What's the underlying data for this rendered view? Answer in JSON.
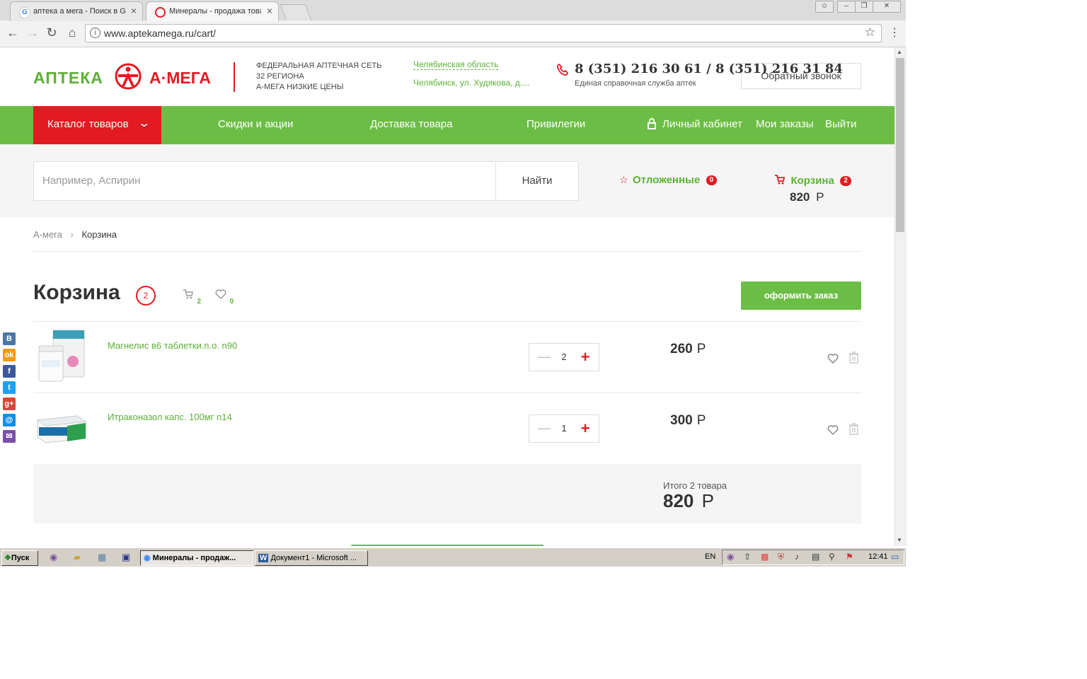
{
  "browser": {
    "tabs": [
      {
        "title": "аптека а мега - Поиск в G",
        "active": false
      },
      {
        "title": "Минералы - продажа това",
        "active": true
      }
    ],
    "url": "www.aptekamega.ru/cart/"
  },
  "header": {
    "logo_left": "АПТЕКА",
    "logo_right": "А·МЕГА",
    "tagline": [
      "ФЕДЕРАЛЬНАЯ АПТЕЧНАЯ СЕТЬ",
      "32 РЕГИОНА",
      "А-МЕГА НИЗКИЕ ЦЕНЫ"
    ],
    "region": "Челябинская область",
    "address": "Челябинск, ул. Худякова, д....",
    "phone": "8 (351) 216 30 61 / 8 (351) 216 31 84",
    "phone_caption": "Единая справочная служба аптек",
    "callback_label": "Обратный звонок"
  },
  "nav": {
    "catalog": "Каталог товаров",
    "items": [
      "Скидки и акции",
      "Доставка товара",
      "Привилегии"
    ],
    "account": "Личный кабинет",
    "orders": "Мои заказы",
    "logout": "Выйти"
  },
  "search": {
    "placeholder": "Например, Аспирин",
    "button": "Найти",
    "deferred_label": "Отложенные",
    "deferred_count": "0",
    "cart_label": "Корзина",
    "cart_count": "2",
    "cart_total": "820",
    "currency": "Р"
  },
  "breadcrumb": {
    "home": "А-мега",
    "current": "Корзина"
  },
  "cart": {
    "title": "Корзина",
    "count": "2",
    "cart_icon_count": "2",
    "fav_icon_count": "0",
    "checkout_label": "оформить заказ",
    "items": [
      {
        "name": "Магнелис в6 таблетки.п.о. n90",
        "qty": "2",
        "price": "260",
        "currency": "Р"
      },
      {
        "name": "Итраконазол капс. 100мг n14",
        "qty": "1",
        "price": "300",
        "currency": "Р"
      }
    ],
    "summary_label": "Итого 2 товара",
    "summary_total": "820",
    "summary_currency": "Р"
  },
  "social": [
    "В",
    "ok",
    "f",
    "t",
    "g+",
    "@",
    "✉"
  ],
  "colors": {
    "green": "#6cbd45",
    "red": "#e21a22",
    "link_green": "#5cb135"
  },
  "taskbar": {
    "start": "Пуск",
    "windows": [
      "Минералы - продаж...",
      "Документ1 - Microsoft ..."
    ],
    "lang": "EN",
    "time": "12:41"
  }
}
